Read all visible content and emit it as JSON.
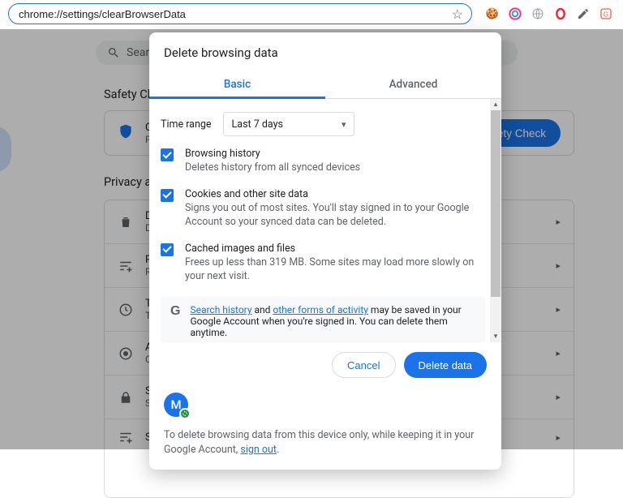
{
  "addressBar": {
    "url": "chrome://settings/clearBrowserData"
  },
  "extensions": [
    "cookie",
    "color-circle",
    "globe",
    "opera",
    "pencil",
    "gram"
  ],
  "background": {
    "searchPlaceholder": "Search",
    "safetyTitle": "Safety Che",
    "safetyCard": {
      "line1": "Ch",
      "line2": "Pa",
      "button": "Safety Check"
    },
    "privacyTitle": "Privacy an",
    "listItems": [
      {
        "icon": "trash",
        "t1": "D",
        "t2": "D"
      },
      {
        "icon": "tune",
        "t1": "P",
        "t2": "R"
      },
      {
        "icon": "clock",
        "t1": "T",
        "t2": "T"
      },
      {
        "icon": "eye",
        "t1": "A",
        "t2": "C"
      },
      {
        "icon": "lock",
        "t1": "S",
        "t2": "S"
      },
      {
        "icon": "tune",
        "t1": "S",
        "t2": ""
      }
    ]
  },
  "modal": {
    "title": "Delete browsing data",
    "tabs": {
      "basic": "Basic",
      "advanced": "Advanced"
    },
    "timeRange": {
      "label": "Time range",
      "value": "Last 7 days"
    },
    "options": [
      {
        "title": "Browsing history",
        "desc": "Deletes history from all synced devices",
        "checked": true
      },
      {
        "title": "Cookies and other site data",
        "desc": "Signs you out of most sites. You'll stay signed in to your Google Account so your synced data can be deleted.",
        "checked": true
      },
      {
        "title": "Cached images and files",
        "desc": "Frees up less than 319 MB. Some sites may load more slowly on your next visit.",
        "checked": true
      }
    ],
    "info": {
      "link1": "Search history",
      "mid1": " and ",
      "link2": "other forms of activity",
      "tail": " may be saved in your Google Account when you're signed in. You can delete them anytime."
    },
    "actions": {
      "cancel": "Cancel",
      "confirm": "Delete data"
    },
    "avatarInitial": "M",
    "footer": {
      "text": "To delete browsing data from this device only, while keeping it in your Google Account, ",
      "link": "sign out",
      "after": "."
    }
  }
}
